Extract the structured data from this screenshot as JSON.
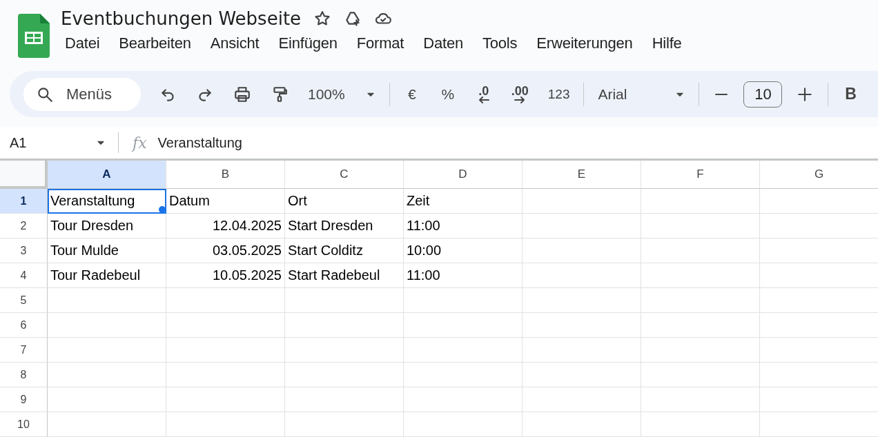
{
  "document": {
    "title": "Eventbuchungen Webseite"
  },
  "menu": [
    "Datei",
    "Bearbeiten",
    "Ansicht",
    "Einfügen",
    "Format",
    "Daten",
    "Tools",
    "Erweiterungen",
    "Hilfe"
  ],
  "toolbar": {
    "search": {
      "placeholder": "Menüs"
    },
    "zoom": "100%",
    "currency": "€",
    "percent": "%",
    "decrease_decimals": ".0",
    "increase_decimals": ".00",
    "number_format": "123",
    "font": "Arial",
    "font_size": "10",
    "bold": "B"
  },
  "formula_bar": {
    "cell_ref": "A1",
    "fx": "fx",
    "value": "Veranstaltung"
  },
  "columns": [
    {
      "label": "A",
      "selected": true
    },
    {
      "label": "B",
      "selected": false
    },
    {
      "label": "C",
      "selected": false
    },
    {
      "label": "D",
      "selected": false
    },
    {
      "label": "E",
      "selected": false
    },
    {
      "label": "F",
      "selected": false
    },
    {
      "label": "G",
      "selected": false
    }
  ],
  "rows": [
    {
      "number": "1",
      "selected": true,
      "cells": [
        {
          "text": "Veranstaltung",
          "kind": "text",
          "selected": true
        },
        {
          "text": "Datum",
          "kind": "text",
          "selected": false
        },
        {
          "text": "Ort",
          "kind": "text",
          "selected": false
        },
        {
          "text": "Zeit",
          "kind": "text",
          "selected": false
        }
      ]
    },
    {
      "number": "2",
      "selected": false,
      "cells": [
        {
          "text": "Tour Dresden",
          "kind": "text",
          "selected": false
        },
        {
          "text": "12.04.2025",
          "kind": "number",
          "selected": false
        },
        {
          "text": "Start Dresden",
          "kind": "text",
          "selected": false
        },
        {
          "text": "11:00",
          "kind": "text",
          "selected": false
        }
      ]
    },
    {
      "number": "3",
      "selected": false,
      "cells": [
        {
          "text": "Tour Mulde",
          "kind": "text",
          "selected": false
        },
        {
          "text": "03.05.2025",
          "kind": "number",
          "selected": false
        },
        {
          "text": "Start Colditz",
          "kind": "text",
          "selected": false
        },
        {
          "text": "10:00",
          "kind": "text",
          "selected": false
        }
      ]
    },
    {
      "number": "4",
      "selected": false,
      "cells": [
        {
          "text": "Tour Radebeul",
          "kind": "text",
          "selected": false
        },
        {
          "text": "10.05.2025",
          "kind": "number",
          "selected": false
        },
        {
          "text": "Start Radebeul",
          "kind": "text",
          "selected": false
        },
        {
          "text": "11:00",
          "kind": "text",
          "selected": false
        }
      ]
    },
    {
      "number": "5",
      "selected": false
    },
    {
      "number": "6",
      "selected": false
    },
    {
      "number": "7",
      "selected": false
    },
    {
      "number": "8",
      "selected": false
    },
    {
      "number": "9",
      "selected": false
    },
    {
      "number": "10",
      "selected": false
    }
  ]
}
